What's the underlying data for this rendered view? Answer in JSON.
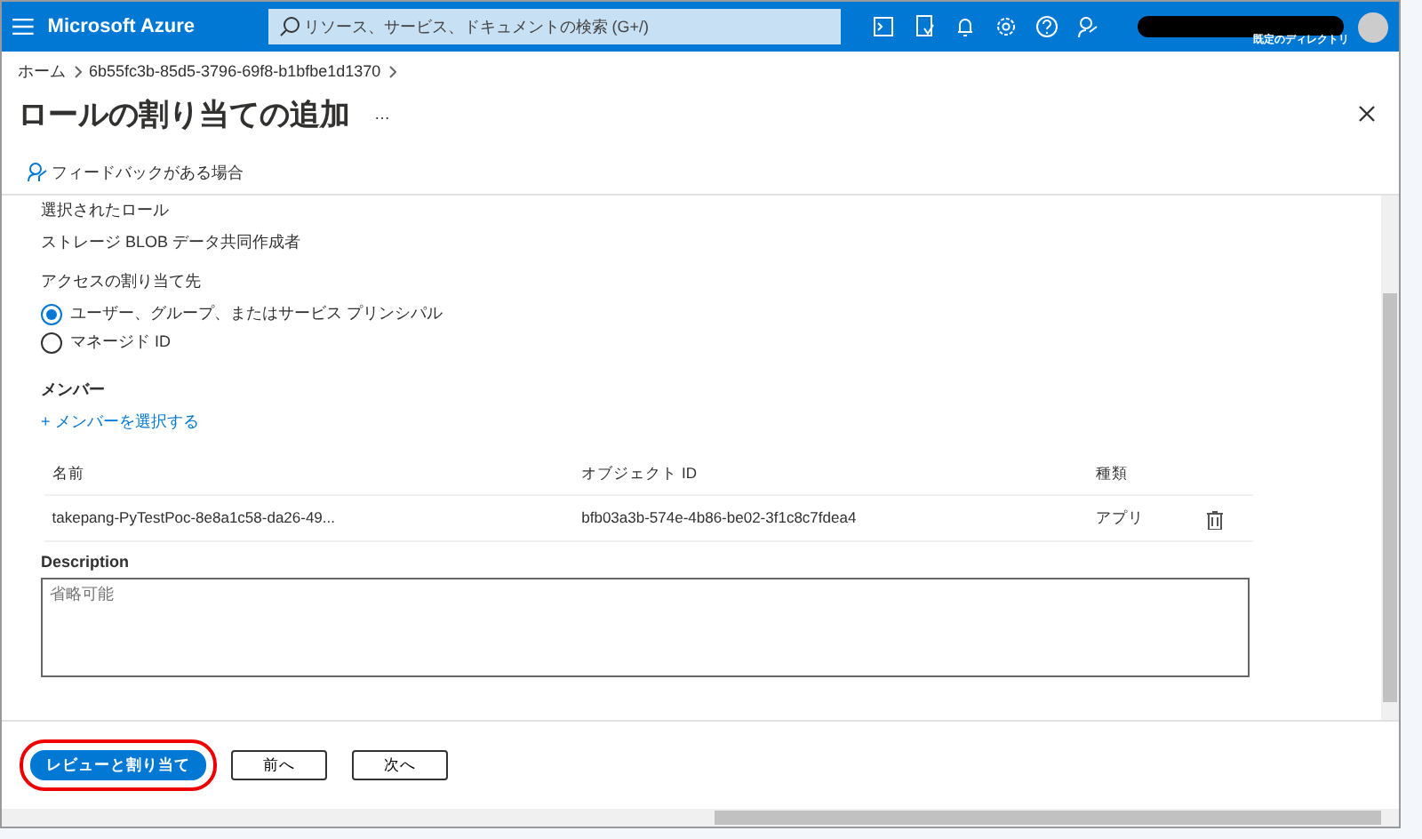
{
  "header": {
    "brand": "Microsoft Azure",
    "search": {
      "placeholder": "リソース、サービス、ドキュメントの検索 (G+/)"
    },
    "directory": "既定のディレクトリ"
  },
  "breadcrumb": [
    "ホーム",
    "6b55fc3b-85d5-3796-69f8-b1bfbe1d1370"
  ],
  "title": "ロールの割り当ての追加",
  "more": "…",
  "feedback": "フィードバックがある場合",
  "selected_role": {
    "label": "選択されたロール",
    "value": "ストレージ BLOB データ共同作成者"
  },
  "assign_to": {
    "label": "アクセスの割り当て先",
    "options": [
      {
        "label": "ユーザー、グループ、またはサービス プリンシパル",
        "selected": true
      },
      {
        "label": "マネージド ID",
        "selected": false
      }
    ]
  },
  "members": {
    "label": "メンバー",
    "add_link": "+ メンバーを選択する"
  },
  "table": {
    "columns": [
      "名前",
      "オブジェクト ID",
      "種類"
    ],
    "rows": [
      [
        "takepang-PyTestPoc-8e8a1c58-da26-49...",
        "bfb03a3b-574e-4b86-be02-3f1c8c7fdea4",
        "アプリ"
      ]
    ]
  },
  "description": {
    "label": "Description",
    "placeholder": "省略可能"
  },
  "buttons": [
    {
      "label": "レビューと割り当て",
      "kind": "primary",
      "highlighted": true
    },
    {
      "label": "前へ",
      "kind": "default",
      "highlighted": false
    },
    {
      "label": "次へ",
      "kind": "default",
      "highlighted": false
    }
  ]
}
